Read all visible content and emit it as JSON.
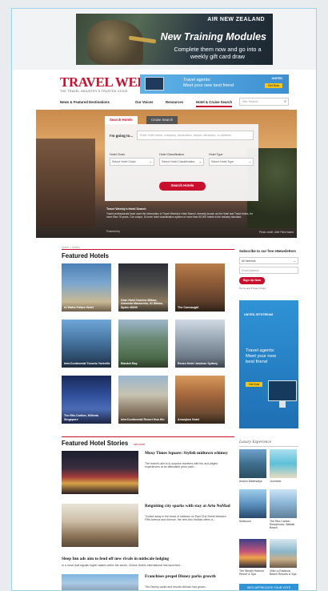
{
  "top_ad": {
    "brand": "AIR NEW ZEALAND",
    "headline": "New Training Modules",
    "subtext": "Complete them now and go into a weekly gift card draw"
  },
  "header": {
    "logo": "TRAVEL WEEKLY",
    "tagline": "THE TRAVEL INDUSTRY'S TRUSTED VOICE",
    "banner_ad": {
      "message_line1": "Travel agents:",
      "message_line2": "Meet your new best friend",
      "airline": "UNITED",
      "cta": "Get Now"
    }
  },
  "nav": {
    "items": [
      "News & Featured Destinations",
      "Our Voices",
      "Resources",
      "Hotel & Cruise Search"
    ],
    "active_index": 3,
    "search_placeholder": "Site Search",
    "search_icon": "search-icon"
  },
  "hero_search": {
    "tabs": [
      "Search Hotels",
      "Cruise Search"
    ],
    "going_label": "I'm going to...",
    "going_placeholder": "Enter hotel name, company, destination, airport, attraction, or address",
    "filters": [
      {
        "label": "Hotel Chain",
        "value": "Select Hotel Chain"
      },
      {
        "label": "Hotel Classification",
        "value": "Select Hotel Classification"
      },
      {
        "label": "Hotel Type",
        "value": "Select Hotel Type"
      }
    ],
    "search_button": "Search Hotels",
    "note_title": "Travel Weekly's Hotel Search",
    "note": "Travel professionals have used the information in Travel Weekly's Hotel Search, formerly known as the Hotel and Travel Index, for more than 75 years. Our unique, 16-level hotel classification system of more than 50,000 hotels is the industry standard.",
    "powered_by": "Powered by",
    "photo_credit": "Photo credit: Little Palm Island"
  },
  "breadcrumb": "Home > Hotels",
  "featured_hotels": {
    "title": "Featured Hotels",
    "cards": [
      {
        "caption": "Al Wafra Palace Hotel"
      },
      {
        "caption": "Gran Hotel Domine Bilbao Alameda Mazarredo, 61 Bilbao, Spain 48009"
      },
      {
        "caption": "The Connaught"
      },
      {
        "caption": "InterContinental Toronto Yorkville"
      },
      {
        "caption": "Blanket Bay"
      },
      {
        "caption": "Renzo Hotel Jamison Sydney"
      },
      {
        "caption": "The Ritz-Carlton, Millenia Singapore"
      },
      {
        "caption": "InterContinental Resort Hua Hin"
      },
      {
        "caption": "Amanjiwo Hotel"
      }
    ]
  },
  "sidebar": {
    "newsletter_title": "Subscribe to our free eNewsletters",
    "interests_value": "All Interests",
    "email_placeholder": "Email Address",
    "signup_button": "Sign Up Now",
    "terms": "Terms and Privacy Policy",
    "ad": {
      "airline": "UNITED  JETSTREAM",
      "text_line1": "Travel agents:",
      "text_line2": "Meet your new",
      "text_line3": "best friend",
      "cta": "Get Now"
    }
  },
  "featured_stories": {
    "title": "Featured Hotel Stories",
    "more": "see more",
    "stories": [
      {
        "title": "Moxy Times Square: Stylish midtown whimsy",
        "summary": "The brand's aim is to surprise travelers with fun and playful experiences at an affordable price point..."
      },
      {
        "title": "Reigniting city sparks with stay at Arlo NoMad",
        "summary": "Tucked away in the heart of midtown on East 31st Street between Fifth Avenue and Avenue, the new Arlo NoMad offers a..."
      }
    ],
    "line_stories": [
      {
        "title": "Sleep Inn ads aim to fend off new rivals in midscale lodging",
        "summary": "In a move that signals higher stakes within the sector, Choice Hotels International has launched..."
      }
    ],
    "last_story": {
      "title": "Franchises propel Disney parks growth",
      "summary": "The Disney parks and resorts division has grown..."
    }
  },
  "luxury": {
    "heading": "Luxury Experience",
    "items": [
      {
        "caption": "Avalon Waterways"
      },
      {
        "caption": "Journese"
      },
      {
        "caption": "Seabourn"
      },
      {
        "caption": "The Ritz-Carlton Residences, Waikiki Beach"
      },
      {
        "caption": "The Westin Harbour Resort & Spa"
      },
      {
        "caption": "Villa La Estancia Beach Resorts & Spa"
      }
    ],
    "banner": "WE'D APPRECIATE YOUR VOTE"
  }
}
